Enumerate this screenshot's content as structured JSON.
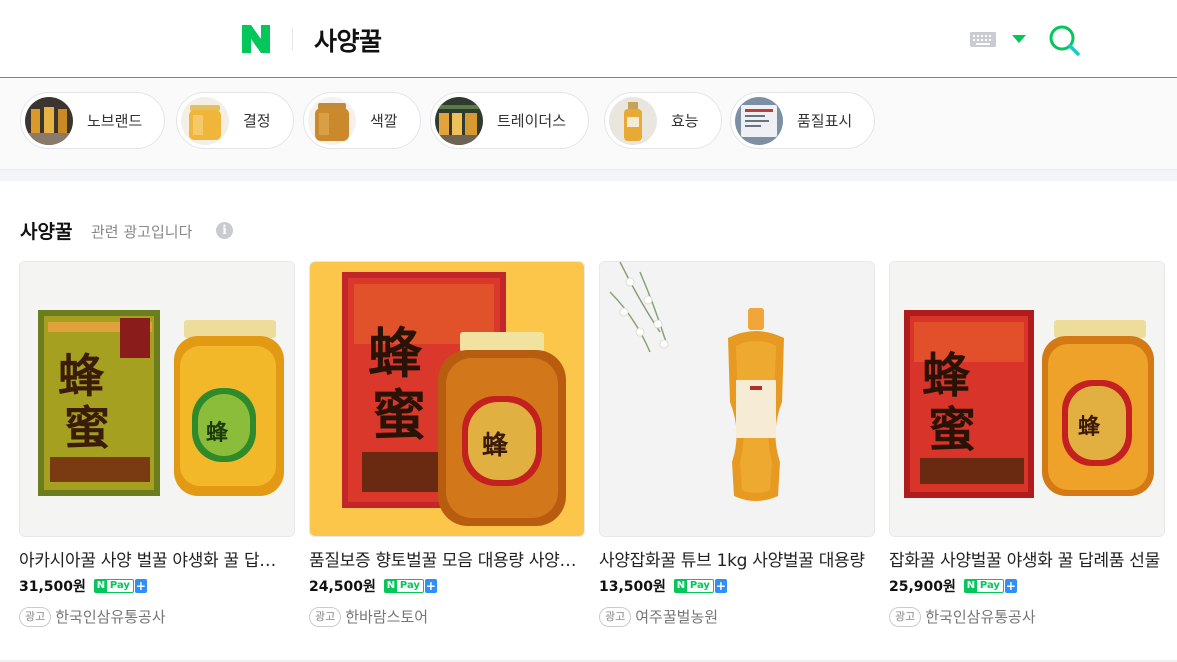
{
  "header": {
    "query": "사양꿀",
    "brand_color": "#03c75a",
    "logo_icon": "naver-n-icon",
    "keyboard_icon": "keyboard-icon",
    "search_icon": "search-icon"
  },
  "filters": [
    {
      "label": "노브랜드"
    },
    {
      "label": "결정"
    },
    {
      "label": "색깔"
    },
    {
      "label": "트레이더스"
    },
    {
      "label": "효능"
    },
    {
      "label": "품질표시"
    }
  ],
  "section": {
    "title": "사양꿀",
    "subtitle": "관련 광고입니다",
    "info_icon": "i"
  },
  "products": [
    {
      "title": "아카시아꿀 사양 벌꿀 야생화 꿀 답례품 선물",
      "price": "31,500원",
      "pay_label": "Pay",
      "pay_plus": "+",
      "ad_label": "광고",
      "seller": "한국인삼유통공사"
    },
    {
      "title": "품질보증 향토벌꿀 모음 대용량 사양벌꿀",
      "price": "24,500원",
      "pay_label": "Pay",
      "pay_plus": "+",
      "ad_label": "광고",
      "seller": "한바람스토어"
    },
    {
      "title": "사양잡화꿀 튜브 1kg 사양벌꿀 대용량",
      "price": "13,500원",
      "pay_label": "Pay",
      "pay_plus": "+",
      "ad_label": "광고",
      "seller": "여주꿀벌농원"
    },
    {
      "title": "잡화꿀 사양벌꿀 야생화 꿀 답례품 선물",
      "price": "25,900원",
      "pay_label": "Pay",
      "pay_plus": "+",
      "ad_label": "광고",
      "seller": "한국인삼유통공사"
    }
  ]
}
